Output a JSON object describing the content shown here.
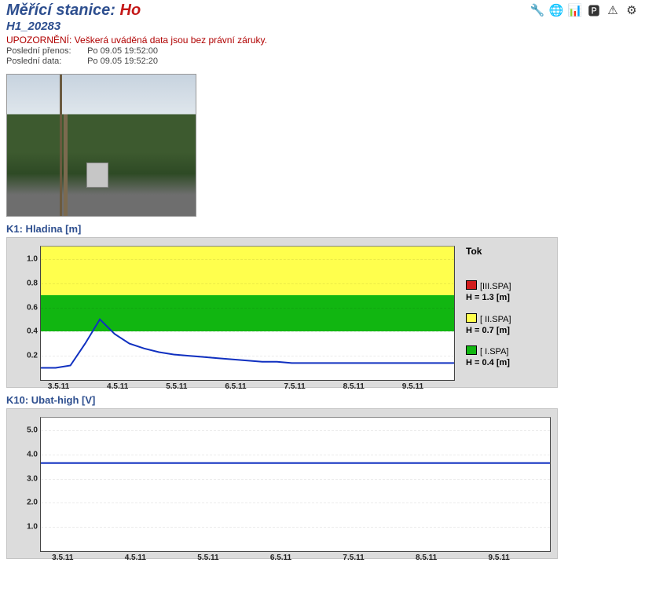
{
  "header": {
    "title_prefix": "Měřící stanice: ",
    "station_name": "Ho",
    "subtitle": "H1_20283"
  },
  "toolbar": {
    "icons": [
      "🔧",
      "🌐",
      "📊",
      "🅿",
      "⚠",
      "⚙"
    ]
  },
  "warning": "UPOZORNĚNÍ: Veškerá uváděná data jsou bez právní záruky.",
  "meta": {
    "last_tx_label": "Poslední přenos:",
    "last_tx_value": "Po 09.05 19:52:00",
    "last_data_label": "Poslední data:",
    "last_data_value": "Po 09.05 19:52:20"
  },
  "chart_data": [
    {
      "id": "k1",
      "caption": "K1: Hladina [m]",
      "type": "line",
      "xlabel": "",
      "ylabel": "",
      "ylim": [
        0.0,
        1.1
      ],
      "yticks": [
        0.2,
        0.4,
        0.6,
        0.8,
        1.0
      ],
      "x_categories": [
        "3.5.11",
        "4.5.11",
        "5.5.11",
        "6.5.11",
        "7.5.11",
        "8.5.11",
        "9.5.11"
      ],
      "bands": [
        {
          "from": 0.7,
          "to": 1.1,
          "color": "#ffff4d"
        },
        {
          "from": 0.4,
          "to": 0.7,
          "color": "#11b611"
        }
      ],
      "series": [
        {
          "name": "Hladina",
          "color": "#1030c0",
          "values": [
            0.1,
            0.1,
            0.12,
            0.3,
            0.5,
            0.38,
            0.3,
            0.26,
            0.23,
            0.21,
            0.2,
            0.19,
            0.18,
            0.17,
            0.16,
            0.15,
            0.15,
            0.14,
            0.14,
            0.14,
            0.14,
            0.14,
            0.14,
            0.14,
            0.14,
            0.14,
            0.14,
            0.14,
            0.14
          ]
        }
      ],
      "legend": {
        "title": "Tok",
        "items": [
          {
            "color": "#d11c1c",
            "label": "[III.SPA]",
            "value": "H = 1.3 [m]"
          },
          {
            "color": "#ffff4d",
            "label": "[ II.SPA]",
            "value": "H = 0.7 [m]"
          },
          {
            "color": "#11b611",
            "label": "[ I.SPA]",
            "value": "H = 0.4 [m]"
          }
        ]
      }
    },
    {
      "id": "k10",
      "caption": "K10: Ubat-high [V]",
      "type": "line",
      "xlabel": "",
      "ylabel": "",
      "ylim": [
        0.0,
        5.5
      ],
      "yticks": [
        1.0,
        2.0,
        3.0,
        4.0,
        5.0
      ],
      "x_categories": [
        "3.5.11",
        "4.5.11",
        "5.5.11",
        "6.5.11",
        "7.5.11",
        "8.5.11",
        "9.5.11"
      ],
      "bands": [],
      "series": [
        {
          "name": "Ubat-high",
          "color": "#1030c0",
          "values": [
            3.63,
            3.63,
            3.63,
            3.63,
            3.63,
            3.63,
            3.63,
            3.63,
            3.63,
            3.63,
            3.63,
            3.63,
            3.63,
            3.63,
            3.63,
            3.63,
            3.63,
            3.63,
            3.63,
            3.63,
            3.63,
            3.63,
            3.63,
            3.63,
            3.63,
            3.63,
            3.63,
            3.63,
            3.63
          ]
        }
      ],
      "legend": null
    }
  ]
}
